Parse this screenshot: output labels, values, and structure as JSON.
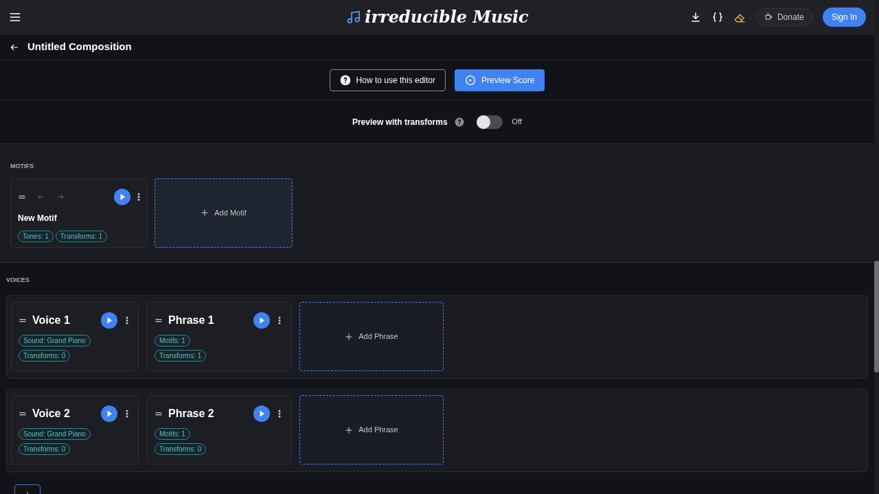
{
  "header": {
    "logo": "irreducible Music",
    "donate": "Donate",
    "sign_in": "Sign In"
  },
  "page": {
    "title": "Untitled Composition"
  },
  "toolbar": {
    "help_button": "How to use this editor",
    "preview_button": "Preview Score"
  },
  "preview_toggle": {
    "label": "Preview with transforms",
    "on": false,
    "state_text": "Off"
  },
  "motifs": {
    "heading": "MOTIFS",
    "add_label": "Add Motif",
    "items": [
      {
        "name": "New Motif",
        "tags": [
          "Tones: 1",
          "Transforms: 1"
        ]
      }
    ]
  },
  "voices": {
    "heading": "VOICES",
    "rows": [
      {
        "name": "Voice 1",
        "tags": [
          "Sound: Grand Piano",
          "Transforms: 0"
        ],
        "phrases": [
          {
            "name": "Phrase 1",
            "tags": [
              "Motifs: 1",
              "Transforms: 1"
            ]
          }
        ],
        "add_label": "Add Phrase"
      },
      {
        "name": "Voice 2",
        "tags": [
          "Sound: Grand Piano",
          "Transforms: 0"
        ],
        "phrases": [
          {
            "name": "Phrase 2",
            "tags": [
              "Motifs: 1",
              "Transforms: 0"
            ]
          }
        ],
        "add_label": "Add Phrase"
      }
    ]
  }
}
